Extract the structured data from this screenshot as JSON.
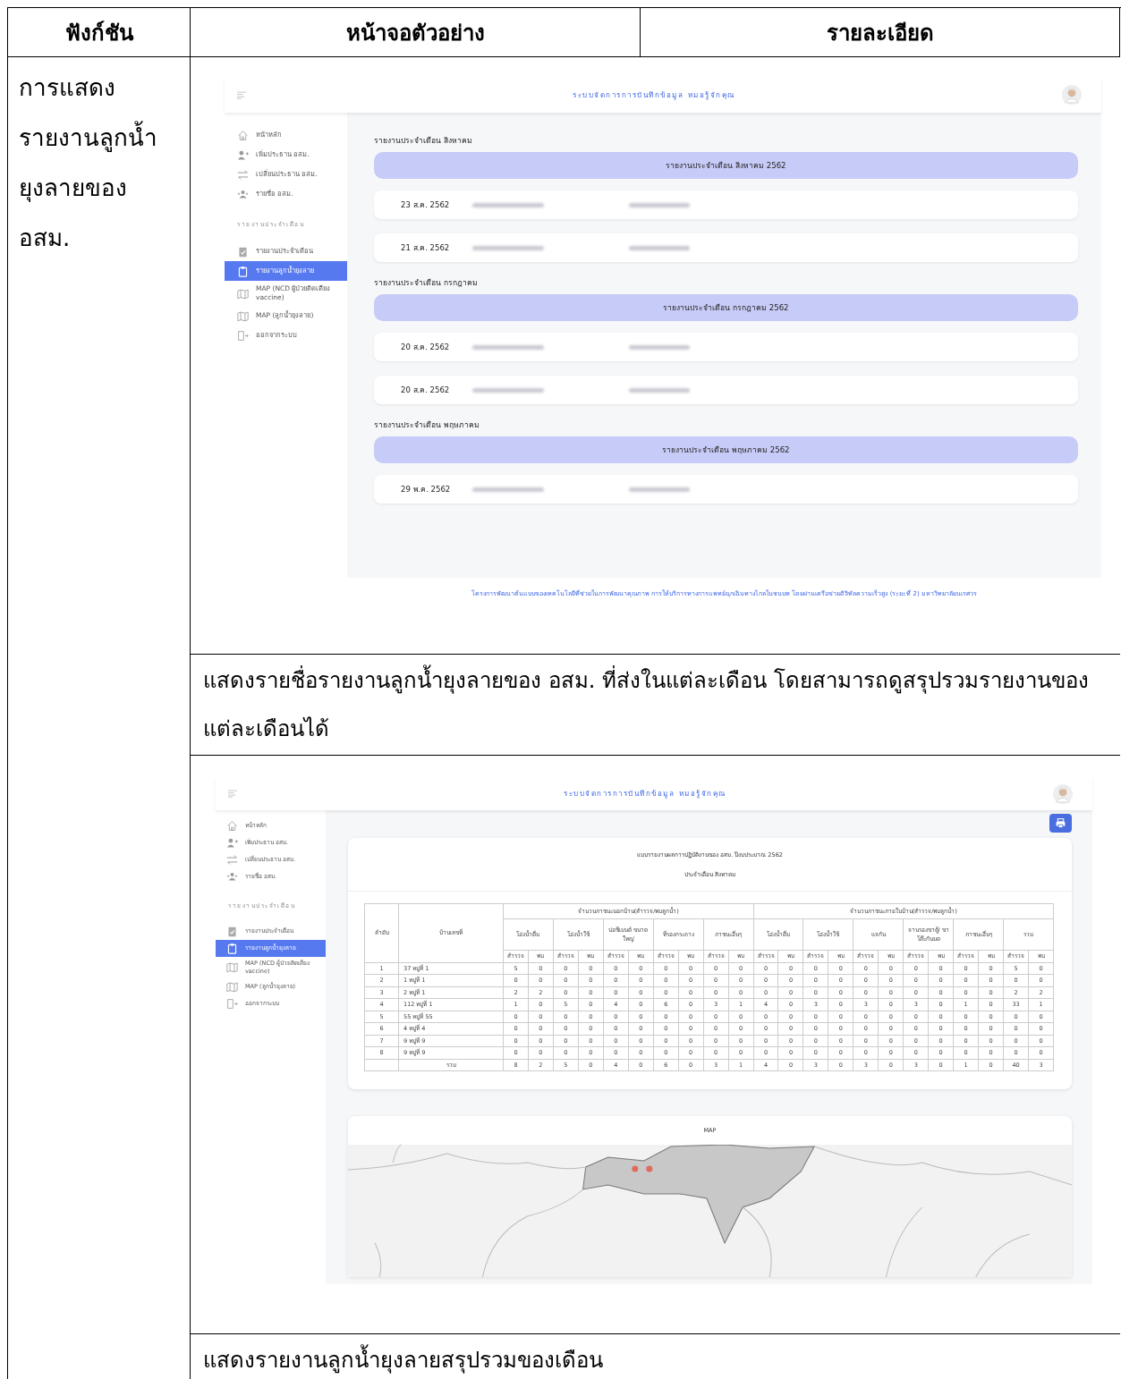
{
  "columns": [
    "ฟังก์ชัน",
    "หน้าจอตัวอย่าง",
    "รายละเอียด"
  ],
  "function_label": "การแสดงรายงานลูกน้ำยุงลายของ อสม.",
  "sections": [
    {
      "kind": "report_list",
      "screen": {
        "app_title": "ระบบจัดการการบันทึกข้อมูล หมอรู้จักคุณ",
        "sidebar": {
          "items": [
            {
              "kind": "home",
              "label": "หน้าหลัก",
              "selected": false
            },
            {
              "kind": "adduser",
              "label": "เพิ่มประธาน อสม.",
              "selected": false
            },
            {
              "kind": "swap",
              "label": "เปลี่ยนประธาน อสม.",
              "selected": false
            },
            {
              "kind": "group",
              "label": "รายชื่อ อสม.",
              "selected": false
            }
          ],
          "section_label": "รายงานประจำเดือน",
          "section_items": [
            {
              "kind": "checklist",
              "label": "รายงานประจำเดือน",
              "selected": false
            },
            {
              "kind": "clipboard",
              "label": "รายงานลูกน้ำยุงลาย",
              "selected": true
            },
            {
              "kind": "map",
              "label": "MAP (NCD ผู้ป่วยติดเตียง vaccine)",
              "selected": false
            },
            {
              "kind": "map",
              "label": "MAP (ลูกน้ำยุงลาย)",
              "selected": false
            },
            {
              "kind": "logout",
              "label": "ออกจากระบบ",
              "selected": false
            }
          ]
        },
        "months": [
          {
            "heading": "รายงานประจำเดือน สิงหาคม",
            "banner": "รายงานประจำเดือน สิงหาคม 2562",
            "entries": [
              {
                "date": "23 ส.ค. 2562"
              },
              {
                "date": "21 ส.ค. 2562"
              }
            ]
          },
          {
            "heading": "รายงานประจำเดือน กรกฎาคม",
            "banner": "รายงานประจำเดือน กรกฎาคม 2562",
            "entries": [
              {
                "date": "20 ส.ค. 2562"
              },
              {
                "date": "20 ส.ค. 2562"
              }
            ]
          },
          {
            "heading": "รายงานประจำเดือน พฤษภาคม",
            "banner": "รายงานประจำเดือน พฤษภาคม 2562",
            "entries": [
              {
                "date": "29 พ.ค. 2562"
              }
            ]
          }
        ],
        "footer": "โครงการพัฒนาต้นแบบของเทคโนโลยีที่ช่วยในการพัฒนาคุณภาพ การให้บริการทางการแพทย์ฉุกเฉินทางไกลในชนบท โดยผ่านเครือข่ายดิจิทัลความเร็วสูง (ระยะที่ 2) มหาวิทยาลัยนเรศวร"
      },
      "description": "แสดงรายชื่อรายงานลูกน้ำยุงลายของ อสม.  ที่ส่งในแต่ละเดือน โดยสามารถดูสรุปรวมรายงานของแต่ละเดือนได้"
    },
    {
      "kind": "report_summary",
      "screen": {
        "app_title": "ระบบจัดการการบันทึกข้อมูล หมอรู้จักคุณ",
        "sidebar": {
          "items": [
            {
              "kind": "home",
              "label": "หน้าหลัก",
              "selected": false
            },
            {
              "kind": "adduser",
              "label": "เพิ่มประธาน อสม.",
              "selected": false
            },
            {
              "kind": "swap",
              "label": "เปลี่ยนประธาน อสม.",
              "selected": false
            },
            {
              "kind": "group",
              "label": "รายชื่อ อสม.",
              "selected": false
            }
          ],
          "section_label": "รายงานประจำเดือน",
          "section_items": [
            {
              "kind": "checklist",
              "label": "รายงานประจำเดือน",
              "selected": false
            },
            {
              "kind": "clipboard",
              "label": "รายงานลูกน้ำยุงลาย",
              "selected": true
            },
            {
              "kind": "map",
              "label": "MAP (NCD ผู้ป่วยติดเตียง vaccine)",
              "selected": false
            },
            {
              "kind": "map",
              "label": "MAP (ลูกน้ำยุงลาย)",
              "selected": false
            },
            {
              "kind": "logout",
              "label": "ออกจากระบบ",
              "selected": false
            }
          ]
        },
        "report": {
          "title": "แบบรายงานผลการปฏิบัติงานของ อสม. ปีงบประมาณ 2562",
          "subtitle": "ประจำเดือน สิงหาคม",
          "index_header": "ลำดับ",
          "house_header": "บ้านเลขที่",
          "groups": [
            {
              "label": "จำนวนภาชนะนอกบ้าน(สำรวจ/พบลูกน้ำ)",
              "containers": [
                {
                  "label": "โอ่งน้ำดื่ม",
                  "sub": [
                    "สำรวจ",
                    "พบ"
                  ]
                },
                {
                  "label": "โอ่งน้ำใช้",
                  "sub": [
                    "สำรวจ",
                    "พบ"
                  ]
                },
                {
                  "label": "บ่อซีเมนต์ ขนาดใหญ่",
                  "sub": [
                    "สำรวจ",
                    "พบ"
                  ]
                },
                {
                  "label": "ที่รองกระถาง",
                  "sub": [
                    "สำรวจ",
                    "พบ"
                  ]
                },
                {
                  "label": "ภาชนะอื่นๆ",
                  "sub": [
                    "สำรวจ",
                    "พบ"
                  ]
                }
              ]
            },
            {
              "label": "จำนวนภาชนะภายในบ้าน(สำรวจ/พบลูกน้ำ)",
              "containers": [
                {
                  "label": "โอ่งน้ำดื่ม",
                  "sub": [
                    "สำรวจ",
                    "พบ"
                  ]
                },
                {
                  "label": "โอ่งน้ำใช้",
                  "sub": [
                    "สำรวจ",
                    "พบ"
                  ]
                },
                {
                  "label": "แจกัน",
                  "sub": [
                    "สำรวจ",
                    "พบ"
                  ]
                },
                {
                  "label": "จานรองขาตู้/ ขาโต๊ะกันมด",
                  "sub": [
                    "สำรวจ",
                    "พบ"
                  ]
                },
                {
                  "label": "ภาชนะอื่นๆ",
                  "sub": [
                    "สำรวจ",
                    "พบ"
                  ]
                },
                {
                  "label": "รวม",
                  "sub": [
                    "สำรวจ",
                    "พบ"
                  ]
                }
              ]
            }
          ],
          "rows": [
            {
              "index": "1",
              "house": "37 หมู่ที่ 1",
              "values": [
                "5",
                "0",
                "0",
                "0",
                "0",
                "0",
                "0",
                "0",
                "0",
                "0",
                "0",
                "0",
                "0",
                "0",
                "0",
                "0",
                "0",
                "0",
                "0",
                "0",
                "5",
                "0"
              ]
            },
            {
              "index": "2",
              "house": "1 หมู่ที่ 1",
              "values": [
                "0",
                "0",
                "0",
                "0",
                "0",
                "0",
                "0",
                "0",
                "0",
                "0",
                "0",
                "0",
                "0",
                "0",
                "0",
                "0",
                "0",
                "0",
                "0",
                "0",
                "0",
                "0"
              ]
            },
            {
              "index": "3",
              "house": "2 หมู่ที่ 1",
              "values": [
                "2",
                "2",
                "0",
                "0",
                "0",
                "0",
                "0",
                "0",
                "0",
                "0",
                "0",
                "0",
                "0",
                "0",
                "0",
                "0",
                "0",
                "0",
                "0",
                "0",
                "2",
                "2"
              ]
            },
            {
              "index": "4",
              "house": "112 หมู่ที่ 1",
              "values": [
                "1",
                "0",
                "5",
                "0",
                "4",
                "0",
                "6",
                "0",
                "3",
                "1",
                "4",
                "0",
                "3",
                "0",
                "3",
                "0",
                "3",
                "0",
                "1",
                "0",
                "33",
                "1"
              ]
            },
            {
              "index": "5",
              "house": "55 หมู่ที่ 55",
              "values": [
                "0",
                "0",
                "0",
                "0",
                "0",
                "0",
                "0",
                "0",
                "0",
                "0",
                "0",
                "0",
                "0",
                "0",
                "0",
                "0",
                "0",
                "0",
                "0",
                "0",
                "0",
                "0"
              ]
            },
            {
              "index": "6",
              "house": "4 หมู่ที่ 4",
              "values": [
                "0",
                "0",
                "0",
                "0",
                "0",
                "0",
                "0",
                "0",
                "0",
                "0",
                "0",
                "0",
                "0",
                "0",
                "0",
                "0",
                "0",
                "0",
                "0",
                "0",
                "0",
                "0"
              ]
            },
            {
              "index": "7",
              "house": "9 หมู่ที่ 9",
              "values": [
                "0",
                "0",
                "0",
                "0",
                "0",
                "0",
                "0",
                "0",
                "0",
                "0",
                "0",
                "0",
                "0",
                "0",
                "0",
                "0",
                "0",
                "0",
                "0",
                "0",
                "0",
                "0"
              ]
            },
            {
              "index": "8",
              "house": "9 หมู่ที่ 9",
              "values": [
                "0",
                "0",
                "0",
                "0",
                "0",
                "0",
                "0",
                "0",
                "0",
                "0",
                "0",
                "0",
                "0",
                "0",
                "0",
                "0",
                "0",
                "0",
                "0",
                "0",
                "0",
                "0"
              ]
            }
          ],
          "total": {
            "label": "รวม",
            "values": [
              "8",
              "2",
              "5",
              "0",
              "4",
              "0",
              "6",
              "0",
              "3",
              "1",
              "4",
              "0",
              "3",
              "0",
              "3",
              "0",
              "3",
              "0",
              "1",
              "0",
              "40",
              "3"
            ]
          }
        },
        "map_title": "MAP"
      },
      "description": "แสดงรายงานลูกน้ำยุงลายสรุปรวมของเดือน"
    }
  ]
}
